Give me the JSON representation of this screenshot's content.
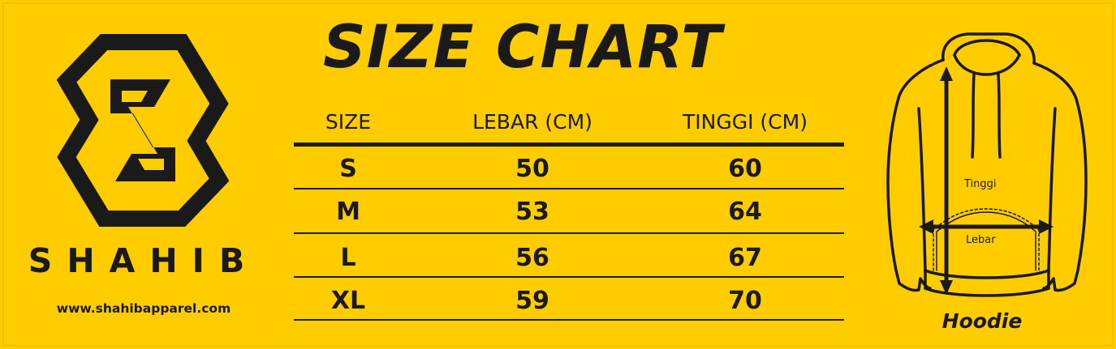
{
  "brand": {
    "name": "SHAHIB",
    "url": "www.shahibapparel.com"
  },
  "title": "SIZE CHART",
  "table": {
    "headers": [
      "SIZE",
      "LEBAR (CM)",
      "TINGGI (CM)"
    ],
    "rows": [
      {
        "size": "S",
        "lebar": "50",
        "tinggi": "60"
      },
      {
        "size": "M",
        "lebar": "53",
        "tinggi": "64"
      },
      {
        "size": "L",
        "lebar": "56",
        "tinggi": "67"
      },
      {
        "size": "XL",
        "lebar": "59",
        "tinggi": "70"
      }
    ]
  },
  "hoodie": {
    "caption": "Hoodie",
    "height_label": "Tinggi",
    "width_label": "Lebar"
  },
  "colors": {
    "background": "#FFCC00",
    "ink": "#1a1a1a"
  }
}
